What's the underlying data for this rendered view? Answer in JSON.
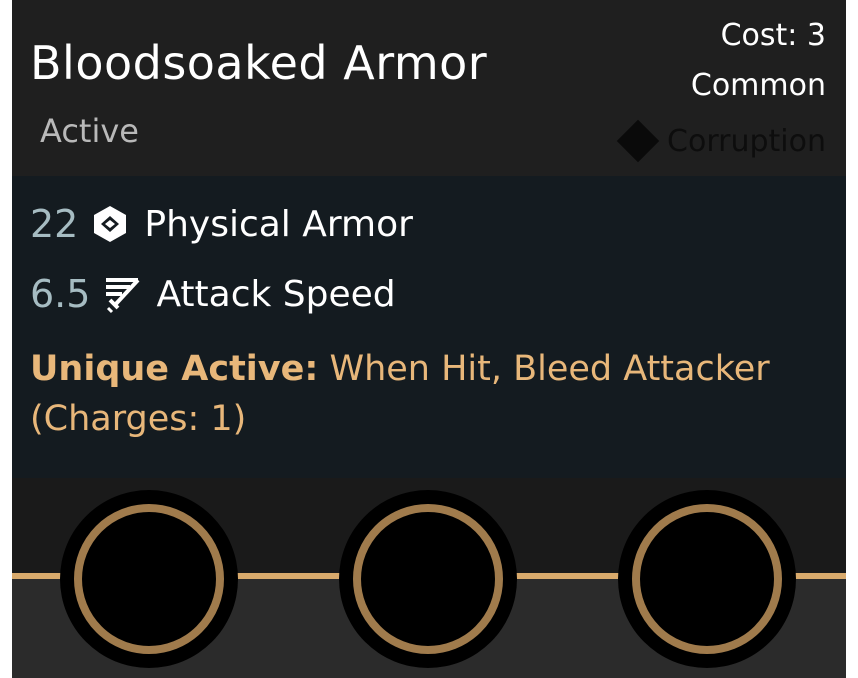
{
  "item": {
    "name": "Bloodsoaked Armor",
    "type": "Active",
    "cost": "Cost: 3",
    "rarity": "Common",
    "tag": "Corruption"
  },
  "stats": [
    {
      "value": "22",
      "label": "Physical Armor",
      "icon": "physical-armor-icon"
    },
    {
      "value": "6.5",
      "label": "Attack Speed",
      "icon": "attack-speed-icon"
    }
  ],
  "ability": {
    "prefix": "Unique Active:",
    "text": " When Hit, Bleed Attacker (Charges: 1)"
  },
  "sockets": [
    {
      "name": "socket-1"
    },
    {
      "name": "socket-2"
    },
    {
      "name": "socket-3"
    }
  ],
  "colors": {
    "header_bg": "#1f1f1f",
    "body_bg": "#141b20",
    "stat_value": "#a6bcc2",
    "ability_text": "#e8b77a",
    "socket_ring": "#a07b4c",
    "divider": "#d9aa6c"
  }
}
